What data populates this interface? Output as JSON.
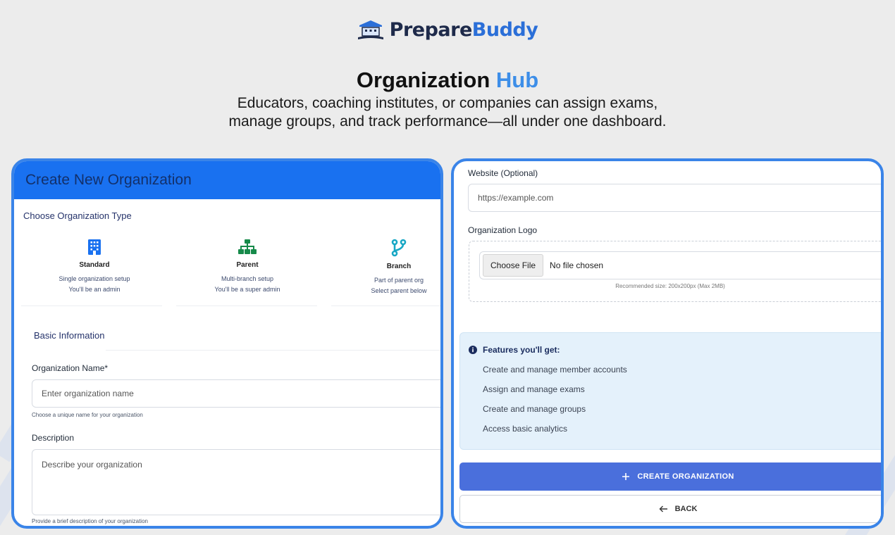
{
  "brand": {
    "logo_icon": "building-icon",
    "name_part1": "Prepare",
    "name_part2": "Buddy"
  },
  "hero": {
    "title_main": "Organization",
    "title_accent": "Hub",
    "subtitle_line1": "Educators, coaching institutes, or companies can assign exams,",
    "subtitle_line2": "manage groups, and track performance—all under one dashboard."
  },
  "create_form": {
    "header": "Create New Organization",
    "type_section_label": "Choose Organization Type",
    "types": [
      {
        "icon": "building-icon",
        "name": "Standard",
        "line1": "Single organization setup",
        "line2": "You'll be an admin"
      },
      {
        "icon": "sitemap-icon",
        "name": "Parent",
        "line1": "Multi-branch setup",
        "line2": "You'll be a super admin"
      },
      {
        "icon": "branch-icon",
        "name": "Branch",
        "line1": "Part of parent org",
        "line2": "Select parent below"
      }
    ],
    "basic_info_label": "Basic Information",
    "org_name_label": "Organization Name*",
    "org_name_placeholder": "Enter organization name",
    "org_name_hint": "Choose a unique name for your organization",
    "description_label": "Description",
    "description_placeholder": "Describe your organization",
    "description_hint": "Provide a brief description of your organization"
  },
  "details_form": {
    "website_label": "Website (Optional)",
    "website_placeholder": "https://example.com",
    "logo_label": "Organization Logo",
    "choose_file_label": "Choose File",
    "no_file_text": "No file chosen",
    "logo_hint": "Recommended size: 200x200px (Max 2MB)",
    "features_title": "Features you'll get:",
    "features": [
      "Create and manage member accounts",
      "Assign and manage exams",
      "Create and manage groups",
      "Access basic analytics"
    ],
    "create_button": "CREATE ORGANIZATION",
    "back_button": "BACK"
  },
  "colors": {
    "accent": "#3a84e8",
    "header_blue": "#1971f0",
    "primary_button": "#4a6fdc",
    "icon_blue": "#1971f0",
    "icon_green": "#168a4a",
    "icon_cyan": "#17a7c4"
  }
}
